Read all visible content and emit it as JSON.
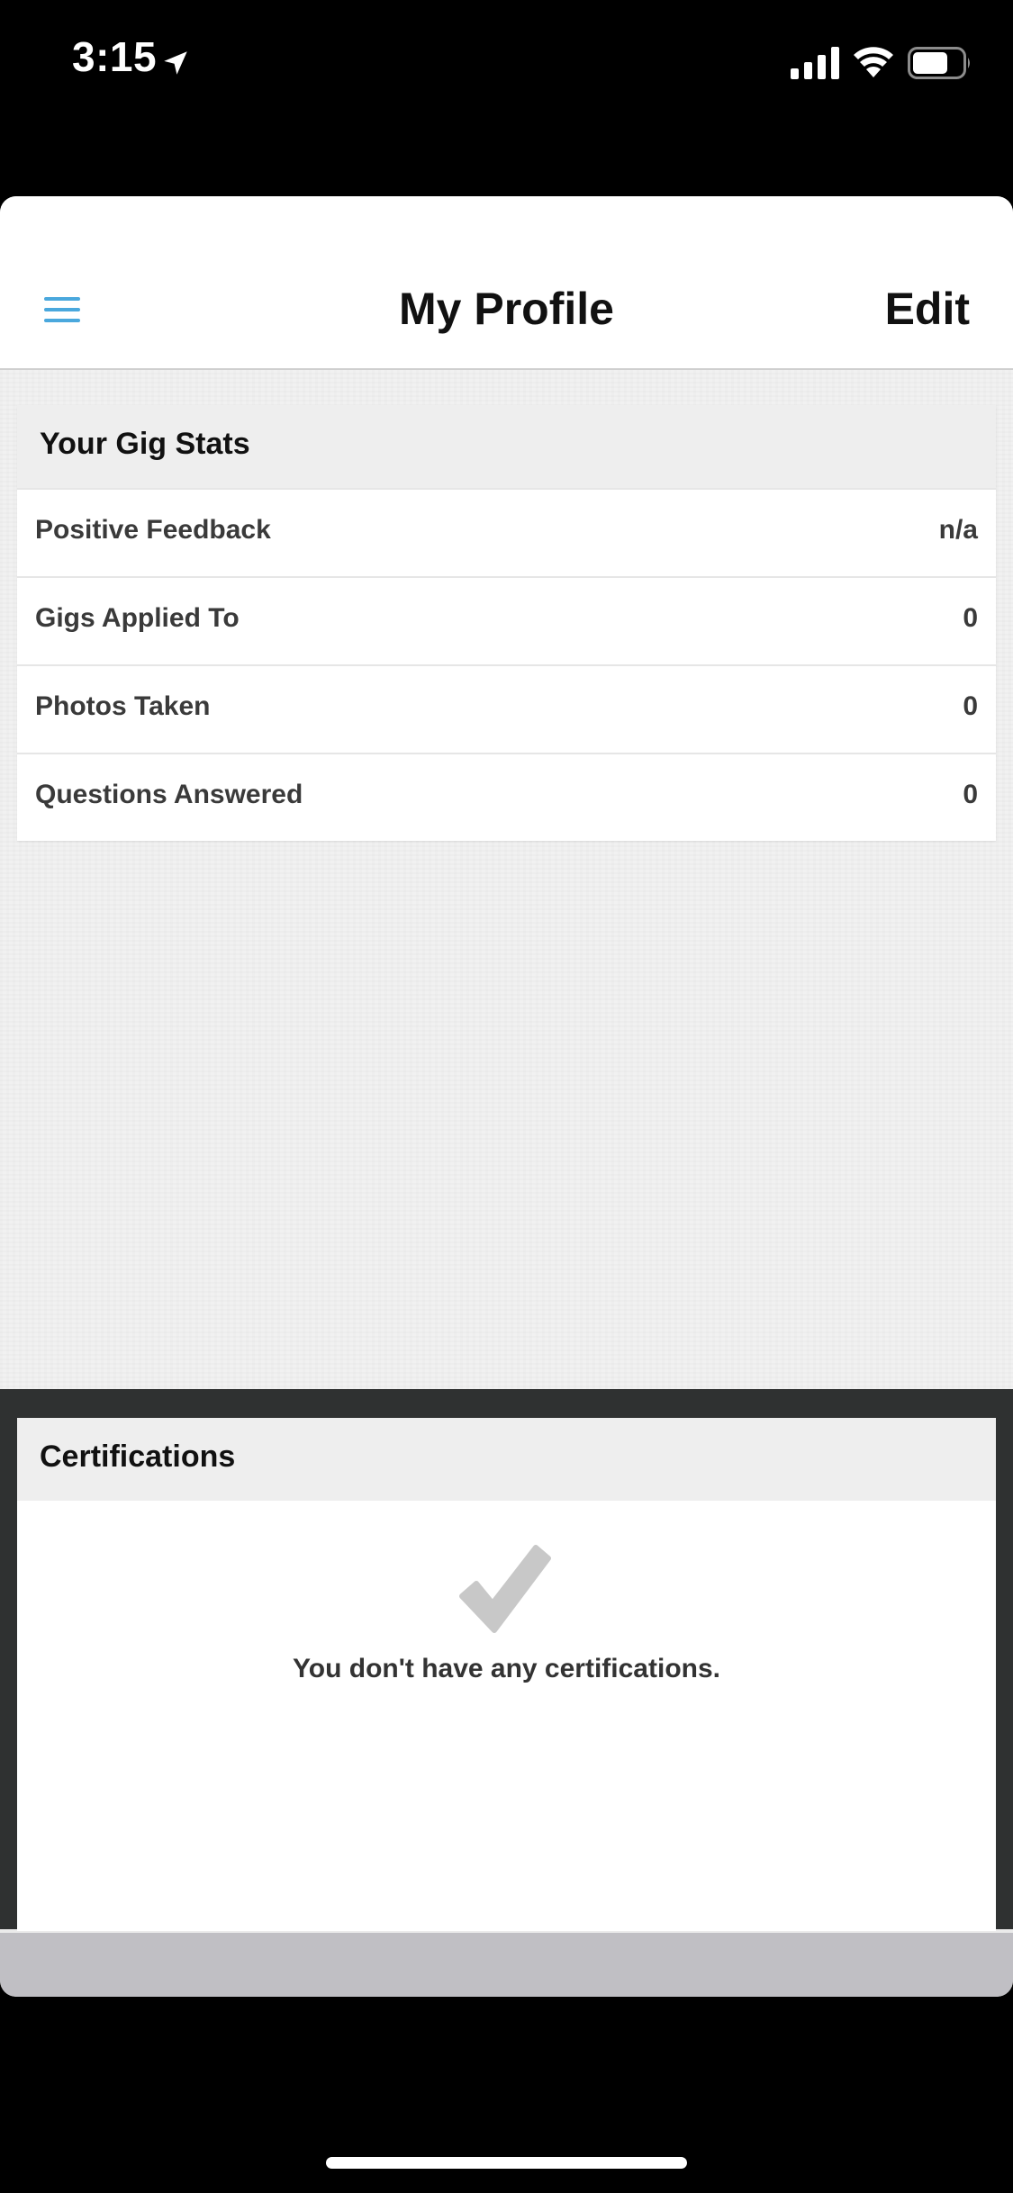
{
  "status_bar": {
    "time": "3:15",
    "icons": [
      "location-arrow-icon",
      "signal-icon",
      "wifi-icon",
      "battery-icon"
    ]
  },
  "nav": {
    "title": "My Profile",
    "edit_label": "Edit",
    "menu_icon": "hamburger-menu-icon",
    "accent_color": "#4aa8dd"
  },
  "gig_stats": {
    "header": "Your Gig Stats",
    "rows": [
      {
        "label": "Positive Feedback",
        "value": "n/a"
      },
      {
        "label": "Gigs Applied To",
        "value": "0"
      },
      {
        "label": "Photos Taken",
        "value": "0"
      },
      {
        "label": "Questions Answered",
        "value": "0"
      }
    ]
  },
  "certifications": {
    "header": "Certifications",
    "empty_icon": "checkmark-icon",
    "empty_message": "You don't have any certifications."
  }
}
